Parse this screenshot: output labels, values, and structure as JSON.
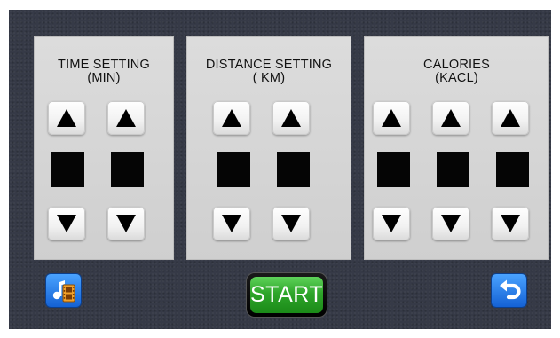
{
  "panels": [
    {
      "id": "time",
      "title_line1": "TIME SETTING",
      "title_line2": "(MIN)",
      "digits": 2
    },
    {
      "id": "distance",
      "title_line1": "DISTANCE SETTING",
      "title_line2": "( KM)",
      "digits": 2
    },
    {
      "id": "calories",
      "title_line1": "CALORIES",
      "title_line2": "(KACL)",
      "digits": 3
    }
  ],
  "start_button": {
    "label": "START"
  },
  "icons": {
    "left": "music-video-icon",
    "right": "back-arrow-icon",
    "up": "triangle-up-icon",
    "down": "triangle-down-icon"
  },
  "colors": {
    "background": "#363a47",
    "panel": "#d5d5d5",
    "start_green": "#2ea52a",
    "icon_blue": "#1f7ae8"
  }
}
